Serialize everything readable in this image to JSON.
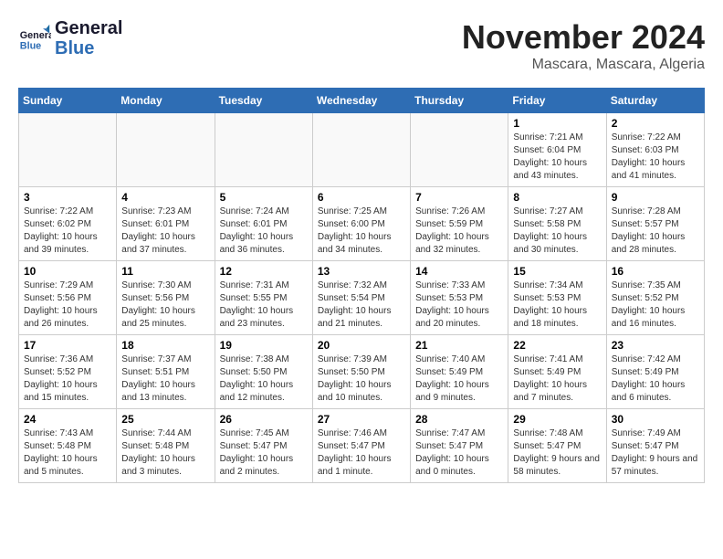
{
  "header": {
    "logo_general": "General",
    "logo_blue": "Blue",
    "month": "November 2024",
    "location": "Mascara, Mascara, Algeria"
  },
  "weekdays": [
    "Sunday",
    "Monday",
    "Tuesday",
    "Wednesday",
    "Thursday",
    "Friday",
    "Saturday"
  ],
  "weeks": [
    [
      {
        "day": "",
        "info": ""
      },
      {
        "day": "",
        "info": ""
      },
      {
        "day": "",
        "info": ""
      },
      {
        "day": "",
        "info": ""
      },
      {
        "day": "",
        "info": ""
      },
      {
        "day": "1",
        "info": "Sunrise: 7:21 AM\nSunset: 6:04 PM\nDaylight: 10 hours and 43 minutes."
      },
      {
        "day": "2",
        "info": "Sunrise: 7:22 AM\nSunset: 6:03 PM\nDaylight: 10 hours and 41 minutes."
      }
    ],
    [
      {
        "day": "3",
        "info": "Sunrise: 7:22 AM\nSunset: 6:02 PM\nDaylight: 10 hours and 39 minutes."
      },
      {
        "day": "4",
        "info": "Sunrise: 7:23 AM\nSunset: 6:01 PM\nDaylight: 10 hours and 37 minutes."
      },
      {
        "day": "5",
        "info": "Sunrise: 7:24 AM\nSunset: 6:01 PM\nDaylight: 10 hours and 36 minutes."
      },
      {
        "day": "6",
        "info": "Sunrise: 7:25 AM\nSunset: 6:00 PM\nDaylight: 10 hours and 34 minutes."
      },
      {
        "day": "7",
        "info": "Sunrise: 7:26 AM\nSunset: 5:59 PM\nDaylight: 10 hours and 32 minutes."
      },
      {
        "day": "8",
        "info": "Sunrise: 7:27 AM\nSunset: 5:58 PM\nDaylight: 10 hours and 30 minutes."
      },
      {
        "day": "9",
        "info": "Sunrise: 7:28 AM\nSunset: 5:57 PM\nDaylight: 10 hours and 28 minutes."
      }
    ],
    [
      {
        "day": "10",
        "info": "Sunrise: 7:29 AM\nSunset: 5:56 PM\nDaylight: 10 hours and 26 minutes."
      },
      {
        "day": "11",
        "info": "Sunrise: 7:30 AM\nSunset: 5:56 PM\nDaylight: 10 hours and 25 minutes."
      },
      {
        "day": "12",
        "info": "Sunrise: 7:31 AM\nSunset: 5:55 PM\nDaylight: 10 hours and 23 minutes."
      },
      {
        "day": "13",
        "info": "Sunrise: 7:32 AM\nSunset: 5:54 PM\nDaylight: 10 hours and 21 minutes."
      },
      {
        "day": "14",
        "info": "Sunrise: 7:33 AM\nSunset: 5:53 PM\nDaylight: 10 hours and 20 minutes."
      },
      {
        "day": "15",
        "info": "Sunrise: 7:34 AM\nSunset: 5:53 PM\nDaylight: 10 hours and 18 minutes."
      },
      {
        "day": "16",
        "info": "Sunrise: 7:35 AM\nSunset: 5:52 PM\nDaylight: 10 hours and 16 minutes."
      }
    ],
    [
      {
        "day": "17",
        "info": "Sunrise: 7:36 AM\nSunset: 5:52 PM\nDaylight: 10 hours and 15 minutes."
      },
      {
        "day": "18",
        "info": "Sunrise: 7:37 AM\nSunset: 5:51 PM\nDaylight: 10 hours and 13 minutes."
      },
      {
        "day": "19",
        "info": "Sunrise: 7:38 AM\nSunset: 5:50 PM\nDaylight: 10 hours and 12 minutes."
      },
      {
        "day": "20",
        "info": "Sunrise: 7:39 AM\nSunset: 5:50 PM\nDaylight: 10 hours and 10 minutes."
      },
      {
        "day": "21",
        "info": "Sunrise: 7:40 AM\nSunset: 5:49 PM\nDaylight: 10 hours and 9 minutes."
      },
      {
        "day": "22",
        "info": "Sunrise: 7:41 AM\nSunset: 5:49 PM\nDaylight: 10 hours and 7 minutes."
      },
      {
        "day": "23",
        "info": "Sunrise: 7:42 AM\nSunset: 5:49 PM\nDaylight: 10 hours and 6 minutes."
      }
    ],
    [
      {
        "day": "24",
        "info": "Sunrise: 7:43 AM\nSunset: 5:48 PM\nDaylight: 10 hours and 5 minutes."
      },
      {
        "day": "25",
        "info": "Sunrise: 7:44 AM\nSunset: 5:48 PM\nDaylight: 10 hours and 3 minutes."
      },
      {
        "day": "26",
        "info": "Sunrise: 7:45 AM\nSunset: 5:47 PM\nDaylight: 10 hours and 2 minutes."
      },
      {
        "day": "27",
        "info": "Sunrise: 7:46 AM\nSunset: 5:47 PM\nDaylight: 10 hours and 1 minute."
      },
      {
        "day": "28",
        "info": "Sunrise: 7:47 AM\nSunset: 5:47 PM\nDaylight: 10 hours and 0 minutes."
      },
      {
        "day": "29",
        "info": "Sunrise: 7:48 AM\nSunset: 5:47 PM\nDaylight: 9 hours and 58 minutes."
      },
      {
        "day": "30",
        "info": "Sunrise: 7:49 AM\nSunset: 5:47 PM\nDaylight: 9 hours and 57 minutes."
      }
    ]
  ]
}
